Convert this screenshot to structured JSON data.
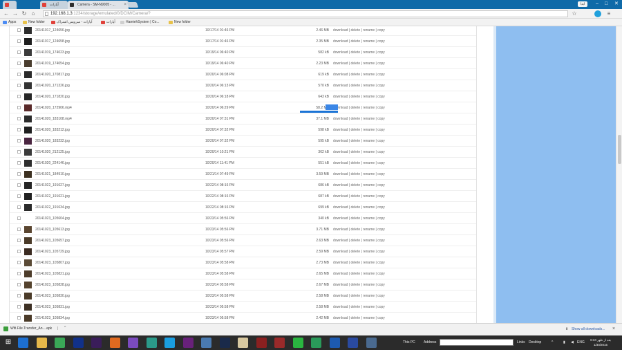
{
  "browser": {
    "tabs": [
      {
        "label": "آپارات",
        "icon": "aparat-icon",
        "active": false
      },
      {
        "label": "آپارات",
        "icon": "aparat-icon",
        "active": false
      },
      {
        "label": "Camera - SM-N9005 - ...",
        "icon": "page-icon",
        "active": true
      }
    ],
    "user_button": "ابدا",
    "window_controls": [
      "–",
      "□",
      "✕"
    ],
    "address": {
      "host": "192.168.1.3",
      "path": ":1234/storage/emulated/0/DCIM/Camera/?"
    },
    "bookmarks": [
      {
        "label": "Apps",
        "color": "#4b8bf4"
      },
      {
        "label": "New folder",
        "color": "#e8c24a"
      },
      {
        "label": "آپارات - سرویس اشتراک",
        "color": "#e0413a"
      },
      {
        "label": "آپارات",
        "color": "#e0413a"
      },
      {
        "label": "HamiehSystem | Co...",
        "color": "#cfcfcf"
      },
      {
        "label": "New folder",
        "color": "#e8c24a"
      }
    ]
  },
  "files": {
    "action_labels": {
      "download": "download",
      "delete": "delete",
      "rename": "rename",
      "copy": "copy",
      "separator": " | "
    },
    "rows": [
      {
        "name": "20141017_124656.jpg",
        "date": "10/17/14 01:46 PM",
        "size": "2.46 MB",
        "thumb": "#2c2c2c"
      },
      {
        "name": "20141017_124658.jpg",
        "date": "10/17/14 01:46 PM",
        "size": "2.35 MB",
        "thumb": "#1e1e1e"
      },
      {
        "name": "20141019_174023.jpg",
        "date": "10/19/14 06:40 PM",
        "size": "582 kB",
        "thumb": "#3a3a3a"
      },
      {
        "name": "20141019_174054.jpg",
        "date": "10/19/14 06:40 PM",
        "size": "2.23 MB",
        "thumb": "#4a3d2e"
      },
      {
        "name": "20141020_170817.jpg",
        "date": "10/20/14 06:08 PM",
        "size": "619 kB",
        "thumb": "#2a2a2a"
      },
      {
        "name": "20141020_171326.jpg",
        "date": "10/20/14 06:13 PM",
        "size": "570 kB",
        "thumb": "#333333"
      },
      {
        "name": "20141020_171820.jpg",
        "date": "10/20/14 06:18 PM",
        "size": "643 kB",
        "thumb": "#262626"
      },
      {
        "name": "20141020_172906.mp4",
        "date": "10/20/14 06:29 PM",
        "size": "58.2 MB",
        "thumb": "#5a2a2a"
      },
      {
        "name": "20141020_183108.mp4",
        "date": "10/20/14 07:31 PM",
        "size": "37.1 MB",
        "thumb": "#2b2b2b"
      },
      {
        "name": "20141020_183212.jpg",
        "date": "10/20/14 07:32 PM",
        "size": "598 kB",
        "thumb": "#1f1f1f"
      },
      {
        "name": "20141020_183232.jpg",
        "date": "10/20/14 07:32 PM",
        "size": "595 kB",
        "thumb": "#4a2540"
      },
      {
        "name": "20141020_212125.jpg",
        "date": "10/20/14 10:21 PM",
        "size": "362 kB",
        "thumb": "#3a3a3a"
      },
      {
        "name": "20141020_224146.jpg",
        "date": "10/20/14 11:41 PM",
        "size": "551 kB",
        "thumb": "#2e2e2e"
      },
      {
        "name": "20141021_184910.jpg",
        "date": "10/21/14 07:49 PM",
        "size": "3.59 MB",
        "thumb": "#3c3020"
      },
      {
        "name": "20141022_191627.jpg",
        "date": "10/22/14 08:16 PM",
        "size": "686 kB",
        "thumb": "#252525"
      },
      {
        "name": "20141022_191621.jpg",
        "date": "10/22/14 08:16 PM",
        "size": "687 kB",
        "thumb": "#202020"
      },
      {
        "name": "20141022_191634.jpg",
        "date": "10/22/14 08:16 PM",
        "size": "699 kB",
        "thumb": "#2a2a2a"
      },
      {
        "name": "20141023_105604.jpg",
        "date": "10/23/14 05:56 PM",
        "size": "340 kB",
        "thumb": ""
      },
      {
        "name": "20141023_105613.jpg",
        "date": "10/23/14 05:56 PM",
        "size": "3.71 MB",
        "thumb": "#5a4530"
      },
      {
        "name": "20141023_105657.jpg",
        "date": "10/23/14 05:56 PM",
        "size": "2.63 MB",
        "thumb": "#4a3a28"
      },
      {
        "name": "20141023_105729.jpg",
        "date": "10/23/14 05:57 PM",
        "size": "2.59 MB",
        "thumb": "#3a2a20"
      },
      {
        "name": "20141023_105807.jpg",
        "date": "10/23/14 05:58 PM",
        "size": "2.73 MB",
        "thumb": "#5a4a35"
      },
      {
        "name": "20141023_105821.jpg",
        "date": "10/23/14 05:58 PM",
        "size": "2.65 MB",
        "thumb": "#4d3c2a"
      },
      {
        "name": "20141023_105828.jpg",
        "date": "10/23/14 05:58 PM",
        "size": "2.67 MB",
        "thumb": "#55432e"
      },
      {
        "name": "20141023_105830.jpg",
        "date": "10/23/14 05:58 PM",
        "size": "2.58 MB",
        "thumb": "#4a3a28"
      },
      {
        "name": "20141023_105831.jpg",
        "date": "10/23/14 05:58 PM",
        "size": "2.58 MB",
        "thumb": "#3d3024"
      },
      {
        "name": "20141023_105834.jpg",
        "date": "10/23/14 05:58 PM",
        "size": "2.42 MB",
        "thumb": "#4a3a28"
      }
    ]
  },
  "download_bar": {
    "item": "Wifi.File.Transfer_An....apk",
    "show_all": "Show all downloads..."
  },
  "taskbar": {
    "thispc_label": "This PC",
    "address_label": "Address",
    "links_label": "Links",
    "desktop_label": "Desktop",
    "lang": "ENG",
    "clock_line1": "بعد از ظهر 6:34",
    "clock_line2": "1/30/2015",
    "apps": [
      {
        "name": "ie-icon",
        "color": "#1d6fd0"
      },
      {
        "name": "file-explorer-icon",
        "color": "#e6b84a"
      },
      {
        "name": "chrome-icon",
        "color": "#3aa757"
      },
      {
        "name": "photoshop-icon",
        "color": "#11318a"
      },
      {
        "name": "premiere-icon",
        "color": "#3a1d5a"
      },
      {
        "name": "firefox-icon",
        "color": "#e06a20"
      },
      {
        "name": "viber-icon",
        "color": "#7b4bbf"
      },
      {
        "name": "app-icon",
        "color": "#2b9a8a"
      },
      {
        "name": "skype-icon",
        "color": "#1a9ee0"
      },
      {
        "name": "visual-studio-icon",
        "color": "#68217a"
      },
      {
        "name": "network-icon",
        "color": "#4a7ab0"
      },
      {
        "name": "media-icon",
        "color": "#1a2a4a"
      },
      {
        "name": "player-icon",
        "color": "#d8c8a0"
      },
      {
        "name": "video-icon",
        "color": "#8a2020"
      },
      {
        "name": "video-icon",
        "color": "#9a2a2a"
      },
      {
        "name": "line-icon",
        "color": "#2ab540"
      },
      {
        "name": "network-share-icon",
        "color": "#2a9a5a"
      },
      {
        "name": "audio-icon",
        "color": "#1d5ab0"
      },
      {
        "name": "tool-icon",
        "color": "#2a4aa0"
      },
      {
        "name": "calculator-icon",
        "color": "#4a6a90"
      }
    ]
  }
}
